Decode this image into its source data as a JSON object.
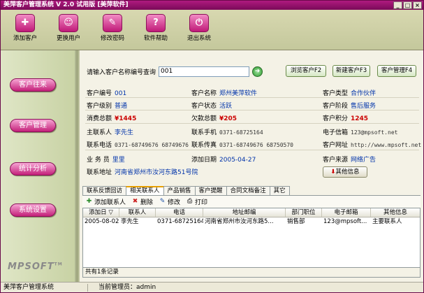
{
  "window": {
    "title": "美萍客户管理系统 V 2.0 试用版 [美萍软件]",
    "controls": [
      "_",
      "□",
      "×"
    ]
  },
  "toolbar": [
    {
      "label": "添加客户",
      "icon": "add-customer-icon",
      "glyph": "✚"
    },
    {
      "label": "更换用户",
      "icon": "switch-user-icon",
      "glyph": "☺"
    },
    {
      "label": "修改密码",
      "icon": "key-icon",
      "glyph": "✎"
    },
    {
      "label": "软件帮助",
      "icon": "help-icon",
      "glyph": "?"
    },
    {
      "label": "退出系统",
      "icon": "exit-icon",
      "glyph": "⏻"
    }
  ],
  "sidebar": [
    {
      "label": "客户往来"
    },
    {
      "label": "客户管理"
    },
    {
      "label": "统计分析"
    },
    {
      "label": "系统设置"
    }
  ],
  "logo": {
    "text": "MPSOFT",
    "tm": "TM"
  },
  "search": {
    "label": "请输入客户名称编号查询",
    "value": "001",
    "go_glyph": "➜"
  },
  "nav_buttons": [
    "浏览客户F2",
    "新建客户F3",
    "客户管理F4"
  ],
  "customer": {
    "code": {
      "label": "客户编号",
      "value": "001"
    },
    "name": {
      "label": "客户名称",
      "value": "郑州美萍软件"
    },
    "type": {
      "label": "客户类型",
      "value": "合作伙伴"
    },
    "level": {
      "label": "客户级别",
      "value": "普通"
    },
    "status": {
      "label": "客户状态",
      "value": "活跃"
    },
    "stage": {
      "label": "客户阶段",
      "value": "售后服务"
    },
    "consume": {
      "label": "消费总额",
      "value": "¥1445"
    },
    "debt": {
      "label": "欠款总额",
      "value": "¥205"
    },
    "points": {
      "label": "客户积分",
      "value": "1245"
    },
    "contact": {
      "label": "主联系人",
      "value": "李先生"
    },
    "mobile": {
      "label": "联系手机",
      "value": "0371-68725164"
    },
    "email": {
      "label": "电子信箱",
      "value": "123@mpsoft.net"
    },
    "phone": {
      "label": "联系电话",
      "value": "0371-68749676 68749676"
    },
    "fax": {
      "label": "联系传真",
      "value": "0371-68749676 68750570"
    },
    "website": {
      "label": "客户网址",
      "value": "http://www.mpsoft.net"
    },
    "salesman": {
      "label": "业 务 员",
      "value": "里里"
    },
    "added": {
      "label": "添加日期",
      "value": "2005-04-27"
    },
    "source": {
      "label": "客户来源",
      "value": "网络广告"
    },
    "address": {
      "label": "联系地址",
      "value": "河南省郑州市汝河东路51号院"
    }
  },
  "other_button": {
    "label": "其他信息",
    "glyph": "⬇"
  },
  "tabs": [
    "联系反馈回访",
    "相关联系人",
    "产品销售",
    "客户提醒",
    "合同文档备注",
    "其它"
  ],
  "active_tab": 1,
  "subtoolbar": [
    {
      "label": "添加联系人",
      "icon": "add-contact-icon",
      "glyph": "✚",
      "color": "#2a8a2a"
    },
    {
      "label": "删除",
      "icon": "delete-icon",
      "glyph": "✖",
      "color": "#cc2222"
    },
    {
      "label": "修改",
      "icon": "edit-icon",
      "glyph": "✎",
      "color": "#2255aa"
    },
    {
      "label": "打印",
      "icon": "print-icon",
      "glyph": "⎙",
      "color": "#555555"
    }
  ],
  "grid": {
    "columns": [
      "添加日 ▽",
      "联系人",
      "电话",
      "地址邮编",
      "部门职位",
      "电子邮箱",
      "其他信息"
    ],
    "rows": [
      [
        "2005-08-02",
        "李先生",
        "0371-68725164",
        "河南省郑州市汝河东路5...",
        "销售部",
        "123@mpsoft...",
        "主要联系人"
      ]
    ],
    "footer": "共有1条记录"
  },
  "status": {
    "app": "美萍客户管理系统",
    "admin_label": "当前管理员：",
    "admin_value": "admin"
  }
}
